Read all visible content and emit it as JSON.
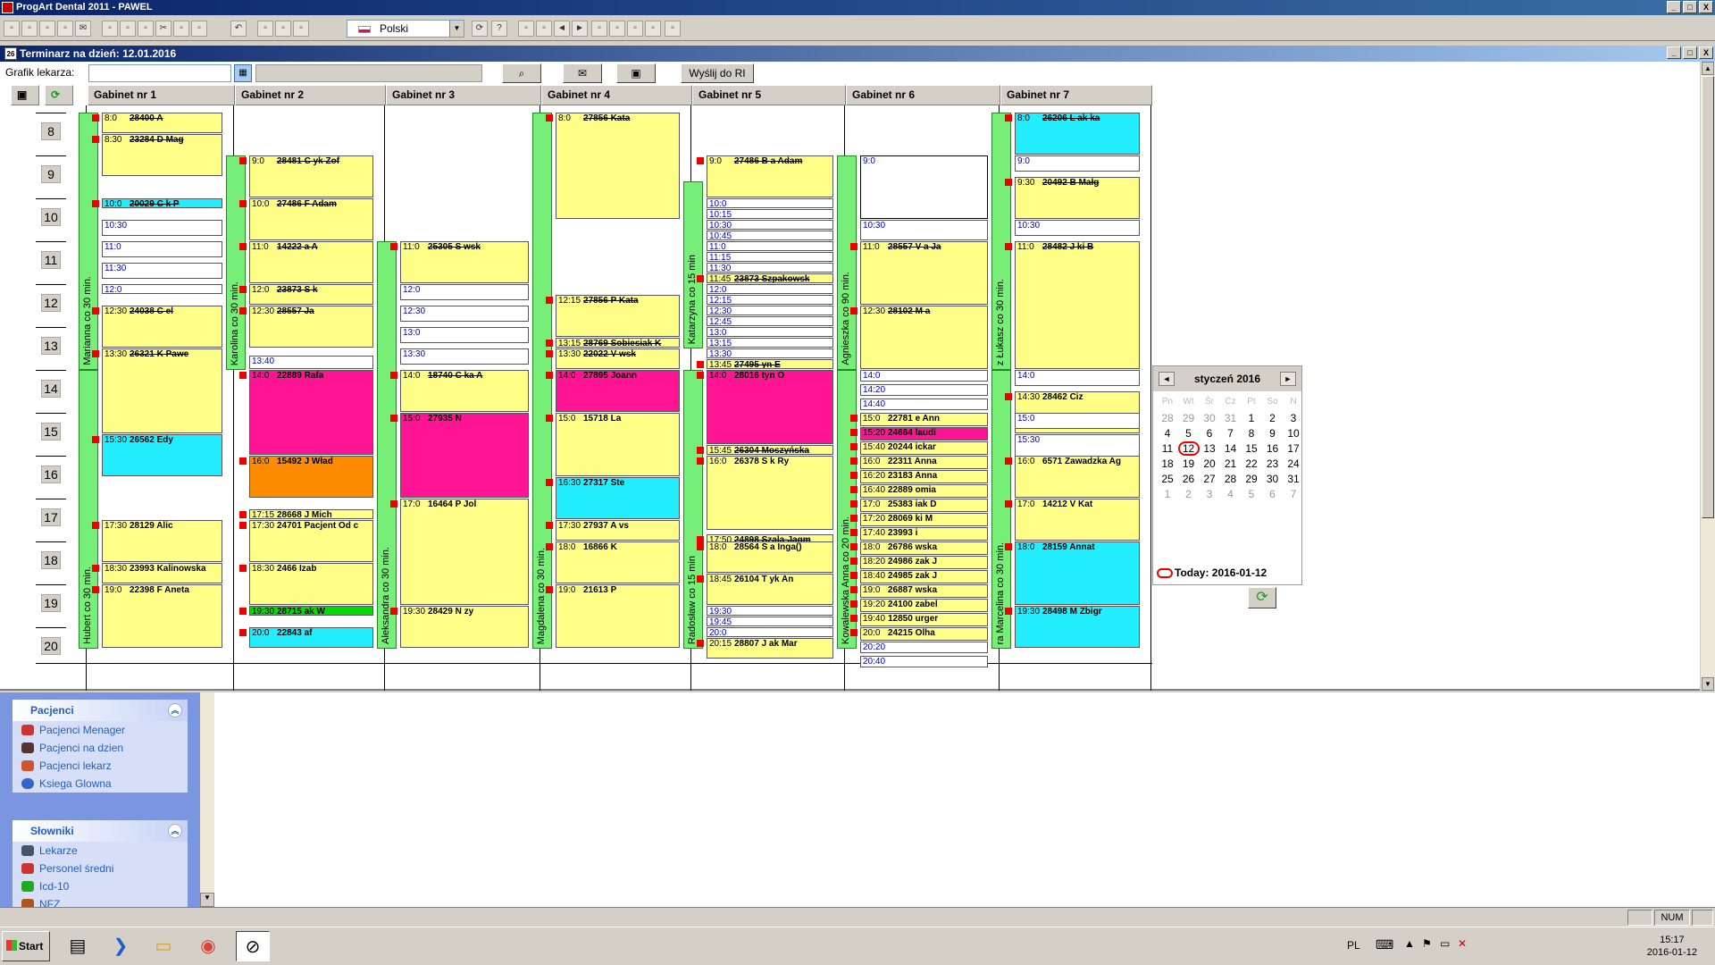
{
  "window": {
    "title": "ProgArt Dental 2011 - PAWEL",
    "btn_min": "_",
    "btn_max": "□",
    "btn_close": "X"
  },
  "toolbar": {
    "language": "Polski"
  },
  "doc": {
    "title": "Terminarz na dzień: 12.01.2016",
    "btn_min": "_",
    "btn_max": "□",
    "btn_close": "X"
  },
  "filter": {
    "label": "Grafik lekarza:",
    "send_ri": "Wyślij do RI"
  },
  "rooms": [
    "Gabinet nr 1",
    "Gabinet nr 2",
    "Gabinet nr 3",
    "Gabinet nr 4",
    "Gabinet nr 5",
    "Gabinet nr 6",
    "Gabinet nr 7"
  ],
  "hours": [
    "8",
    "9",
    "10",
    "11",
    "12",
    "13",
    "14",
    "15",
    "16",
    "17",
    "18",
    "19",
    "20"
  ],
  "doctors": [
    {
      "label": "Marianna co 30 min."
    },
    {
      "label": "Hubert co 30 min."
    },
    {
      "label": "Karolina co 30 min."
    },
    {
      "label": "Aleksandra co 30 min."
    },
    {
      "label": "Magdalena co 30 min."
    },
    {
      "label": "Katarzyna co 15 min"
    },
    {
      "label": "Radosław co 15 min"
    },
    {
      "label": "Kowalewska Anna co 20 min."
    },
    {
      "label": "Agnieszka co 90 min."
    },
    {
      "label": "z Łukasz co 30 min."
    },
    {
      "label": "ra Marcelina co 30 min."
    }
  ],
  "appointments": [
    {
      "t": "8:0",
      "n": "28400 A",
      "c": "yel",
      "s": true
    },
    {
      "t": "8:30",
      "n": "23284 D   Mag",
      "c": "yel",
      "s": true
    },
    {
      "t": "10:0",
      "n": "20029 C    k P",
      "c": "cya",
      "s": true
    },
    {
      "t": "10:30",
      "n": "",
      "c": "wht"
    },
    {
      "t": "11:0",
      "n": "",
      "c": "wht"
    },
    {
      "t": "11:30",
      "n": "",
      "c": "wht"
    },
    {
      "t": "12:0",
      "n": "",
      "c": "wht"
    },
    {
      "t": "12:30",
      "n": "24038 C     el",
      "c": "yel",
      "s": true
    },
    {
      "t": "13:30",
      "n": "26321 K     Pawe",
      "c": "yel",
      "s": true
    },
    {
      "t": "15:30",
      "n": "26562       Edy",
      "c": "cya"
    },
    {
      "t": "17:30",
      "n": "28129       Alic",
      "c": "yel"
    },
    {
      "t": "18:30",
      "n": "23993 Kalinowska",
      "c": "yel"
    },
    {
      "t": "19:0",
      "n": "22398 F    Aneta",
      "c": "yel"
    },
    {
      "t": "9:0",
      "n": "28481 C   yk Zof",
      "c": "yel",
      "s": true
    },
    {
      "t": "10:0",
      "n": "27486 F   Adam",
      "c": "yel",
      "s": true
    },
    {
      "t": "11:0",
      "n": "14222     a A",
      "c": "yel",
      "s": true
    },
    {
      "t": "12:0",
      "n": "23873 S     k",
      "c": "yel",
      "s": true
    },
    {
      "t": "12:30",
      "n": "28557      Ja",
      "c": "yel",
      "s": true
    },
    {
      "t": "13:40",
      "n": "",
      "c": "wht"
    },
    {
      "t": "14:0",
      "n": "22889     Rafa",
      "c": "mag"
    },
    {
      "t": "16:0",
      "n": "15492 J    Wład",
      "c": "ora"
    },
    {
      "t": "17:15",
      "n": "28668 J    Mich",
      "c": "yel"
    },
    {
      "t": "17:30",
      "n": "24701 Pacjent Od c",
      "c": "yel"
    },
    {
      "t": "18:30",
      "n": "2466      Izab",
      "c": "yel"
    },
    {
      "t": "19:30",
      "n": "28715     ak W",
      "c": "grn"
    },
    {
      "t": "20:0",
      "n": "22843      af",
      "c": "cya"
    },
    {
      "t": "11:0",
      "n": "25305 S    wsk",
      "c": "yel",
      "s": true
    },
    {
      "t": "12:0",
      "n": "",
      "c": "wht"
    },
    {
      "t": "12:30",
      "n": "",
      "c": "wht"
    },
    {
      "t": "13:0",
      "n": "",
      "c": "wht"
    },
    {
      "t": "13:30",
      "n": "",
      "c": "wht"
    },
    {
      "t": "14:0",
      "n": "18740 C    ka A",
      "c": "yel",
      "s": true
    },
    {
      "t": "15:0",
      "n": "27935 N",
      "c": "mag"
    },
    {
      "t": "17:0",
      "n": "16464 P     Jol",
      "c": "yel"
    },
    {
      "t": "19:30",
      "n": "28429 N     zy",
      "c": "yel"
    },
    {
      "t": "8:0",
      "n": "27856     Kata",
      "c": "yel",
      "s": true
    },
    {
      "t": "12:15",
      "n": "27856 P    Kata",
      "c": "yel",
      "s": true
    },
    {
      "t": "13:15",
      "n": "28769 Sobiesiak K",
      "c": "yel",
      "s": true
    },
    {
      "t": "13:30",
      "n": "22022 V    wsk",
      "c": "yel",
      "s": true
    },
    {
      "t": "14:0",
      "n": "27895    Joann",
      "c": "mag"
    },
    {
      "t": "15:0",
      "n": "15718      La",
      "c": "yel"
    },
    {
      "t": "16:30",
      "n": "27317      Ste",
      "c": "cya"
    },
    {
      "t": "17:30",
      "n": "27937 A    vs",
      "c": "yel"
    },
    {
      "t": "18:0",
      "n": "16866 K",
      "c": "yel"
    },
    {
      "t": "19:0",
      "n": "21613 P",
      "c": "yel"
    },
    {
      "t": "9:0",
      "n": "27486 B    a Adam",
      "c": "yel",
      "s": true
    },
    {
      "t": "10:0",
      "n": "",
      "c": "wht"
    },
    {
      "t": "10:15",
      "n": "",
      "c": "wht"
    },
    {
      "t": "10:30",
      "n": "",
      "c": "wht"
    },
    {
      "t": "10:45",
      "n": "",
      "c": "wht"
    },
    {
      "t": "11:0",
      "n": "",
      "c": "wht"
    },
    {
      "t": "11:15",
      "n": "",
      "c": "wht"
    },
    {
      "t": "11:30",
      "n": "",
      "c": "wht"
    },
    {
      "t": "11:45",
      "n": "23873 Szpakowsk",
      "c": "yel",
      "s": true
    },
    {
      "t": "12:0",
      "n": "",
      "c": "wht"
    },
    {
      "t": "12:15",
      "n": "",
      "c": "wht"
    },
    {
      "t": "12:30",
      "n": "",
      "c": "wht"
    },
    {
      "t": "12:45",
      "n": "",
      "c": "wht"
    },
    {
      "t": "13:0",
      "n": "",
      "c": "wht"
    },
    {
      "t": "13:15",
      "n": "",
      "c": "wht"
    },
    {
      "t": "13:30",
      "n": "",
      "c": "wht"
    },
    {
      "t": "13:45",
      "n": "27495     yn E",
      "c": "yel",
      "s": true
    },
    {
      "t": "14:0",
      "n": "28016     tyn O",
      "c": "mag"
    },
    {
      "t": "15:45",
      "n": "26304 Moszyńska",
      "c": "yel",
      "s": true
    },
    {
      "t": "16:0",
      "n": "26378 S     k Ry",
      "c": "yel"
    },
    {
      "t": "17:50",
      "n": "24898 Szala-Jagm",
      "c": "yel",
      "s": true
    },
    {
      "t": "18:0",
      "n": "28564 S   a Inga()",
      "c": "yel"
    },
    {
      "t": "18:45",
      "n": "26104 T    yk An",
      "c": "yel"
    },
    {
      "t": "19:30",
      "n": "",
      "c": "wht"
    },
    {
      "t": "19:45",
      "n": "",
      "c": "wht"
    },
    {
      "t": "20:0",
      "n": "",
      "c": "wht"
    },
    {
      "t": "20:15",
      "n": "28807 J    ak Mar",
      "c": "yel"
    },
    {
      "t": "9:0",
      "n": "",
      "c": "whtb"
    },
    {
      "t": "10:30",
      "n": "",
      "c": "wht"
    },
    {
      "t": "11:0",
      "n": "28557 V    a Ja",
      "c": "yel",
      "s": true
    },
    {
      "t": "12:30",
      "n": "28102 M     a",
      "c": "yel",
      "s": true
    },
    {
      "t": "14:0",
      "n": "",
      "c": "wht"
    },
    {
      "t": "14:20",
      "n": "",
      "c": "wht"
    },
    {
      "t": "14:40",
      "n": "",
      "c": "wht"
    },
    {
      "t": "15:0",
      "n": "22781    e Ann",
      "c": "yel"
    },
    {
      "t": "15:20",
      "n": "24664    laudi",
      "c": "mag"
    },
    {
      "t": "15:40",
      "n": "20244    ickar",
      "c": "yel"
    },
    {
      "t": "16:0",
      "n": "22311    Anna",
      "c": "yel"
    },
    {
      "t": "16:20",
      "n": "23183    Anna",
      "c": "yel"
    },
    {
      "t": "16:40",
      "n": "22889    omia",
      "c": "yel"
    },
    {
      "t": "17:0",
      "n": "25383    iak D",
      "c": "yel"
    },
    {
      "t": "17:20",
      "n": "28069    ki M",
      "c": "yel"
    },
    {
      "t": "17:40",
      "n": "23993    i",
      "c": "yel"
    },
    {
      "t": "18:0",
      "n": "26786    wska",
      "c": "yel"
    },
    {
      "t": "18:20",
      "n": "24986    zak J",
      "c": "yel"
    },
    {
      "t": "18:40",
      "n": "24985    zak J",
      "c": "yel"
    },
    {
      "t": "19:0",
      "n": "26887    wska",
      "c": "yel"
    },
    {
      "t": "19:20",
      "n": "24100    zabel",
      "c": "yel"
    },
    {
      "t": "19:40",
      "n": "12850    urger",
      "c": "yel"
    },
    {
      "t": "20:0",
      "n": "24215    Olha",
      "c": "yel"
    },
    {
      "t": "20:20",
      "n": "",
      "c": "wht"
    },
    {
      "t": "20:40",
      "n": "",
      "c": "wht"
    },
    {
      "t": "8:0",
      "n": "26206 L    ak ka",
      "c": "cya",
      "s": true
    },
    {
      "t": "9:0",
      "n": "",
      "c": "wht"
    },
    {
      "t": "9:30",
      "n": "20492 B    Małg",
      "c": "yel",
      "s": true
    },
    {
      "t": "10:30",
      "n": "",
      "c": "wht"
    },
    {
      "t": "11:0",
      "n": "28482 J     ki B",
      "c": "yel",
      "s": true
    },
    {
      "t": "14:0",
      "n": "",
      "c": "wht"
    },
    {
      "t": "14:30",
      "n": "28462     Ciz",
      "c": "yel"
    },
    {
      "t": "15:0",
      "n": "",
      "c": "wht"
    },
    {
      "t": "15:30",
      "n": "",
      "c": "wht"
    },
    {
      "t": "16:0",
      "n": "6571 Zawadzka Ag",
      "c": "yel"
    },
    {
      "t": "17:0",
      "n": "14212 V    Kat",
      "c": "yel"
    },
    {
      "t": "18:0",
      "n": "28159     Annat",
      "c": "cya"
    },
    {
      "t": "19:30",
      "n": "28498 M    Zbigr",
      "c": "cya"
    }
  ],
  "calendar": {
    "title": "styczeń 2016",
    "prev": "◄",
    "next": "►",
    "weekdays": [
      "Pn",
      "Wt",
      "Śr",
      "Cz",
      "Pt",
      "So",
      "N"
    ],
    "days": [
      "28",
      "29",
      "30",
      "31",
      "1",
      "2",
      "3",
      "4",
      "5",
      "6",
      "7",
      "8",
      "9",
      "10",
      "11",
      "12",
      "13",
      "14",
      "15",
      "16",
      "17",
      "18",
      "19",
      "20",
      "21",
      "22",
      "23",
      "24",
      "25",
      "26",
      "27",
      "28",
      "29",
      "30",
      "31",
      "1",
      "2",
      "3",
      "4",
      "5",
      "6",
      "7"
    ],
    "today": "Today: 2016-01-12"
  },
  "sidebar": {
    "groups": [
      {
        "title": "Pacjenci",
        "items": [
          "Pacjenci Menager",
          "Pacjenci na dzien",
          "Pacjenci lekarz",
          "Ksiega Glowna"
        ]
      },
      {
        "title": "Słowniki",
        "items": [
          "Lekarze",
          "Personel średni",
          "Icd-10",
          "NFZ"
        ]
      }
    ]
  },
  "status": {
    "num": "NUM"
  },
  "taskbar": {
    "start": "Start",
    "lang": "PL",
    "time": "15:17",
    "date": "2016-01-12"
  }
}
